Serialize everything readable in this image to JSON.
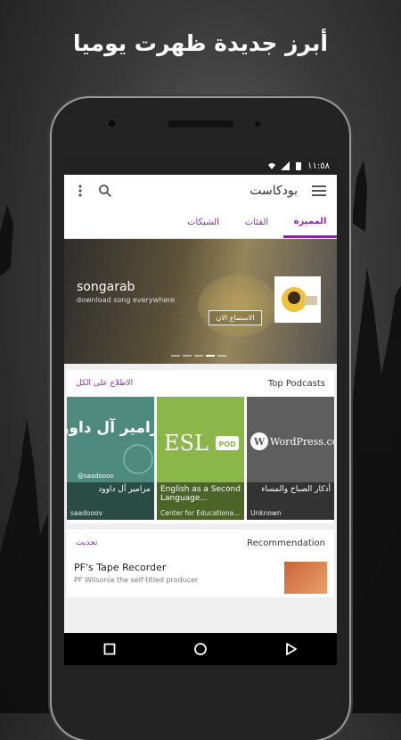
{
  "promo": {
    "headline": "أبرز جديدة ظهرت يوميا"
  },
  "status_bar": {
    "time": "١١:٥٨"
  },
  "app_bar": {
    "title": "بودكاست"
  },
  "tabs": [
    {
      "label": "المميزة",
      "active": true
    },
    {
      "label": "الفئات",
      "active": false
    },
    {
      "label": "الشبكات",
      "active": false
    }
  ],
  "banner": {
    "title": "songarab",
    "subtitle": "download song everywhere",
    "button_label": "الاستماع الان",
    "slides": 5,
    "active_slide": 4
  },
  "top_podcasts": {
    "section_label": "Top Podcasts",
    "see_all_label": "الاطلاع على الكل",
    "items": [
      {
        "title": "مزامير آل داوود",
        "author": "saadooov",
        "art_text": "مزامير آل داوود",
        "art_handle": "@saadooov"
      },
      {
        "title": "English as a Second Language...",
        "author": "Center for Educationa...",
        "art_text": "ESL",
        "art_badge": "POD"
      },
      {
        "title": "أذكار الصباح والمساء",
        "author": "Unknown",
        "art_text": "WordPress.com"
      }
    ]
  },
  "recommendation": {
    "section_label": "Recommendation",
    "refresh_label": "تحديث",
    "items": [
      {
        "title": "PF's Tape Recorder",
        "subtitle": "PF Wilsonia the self-titled producer"
      }
    ]
  },
  "colors": {
    "accent": "#7b2a96",
    "banner_dark": "#3e3e3e"
  }
}
